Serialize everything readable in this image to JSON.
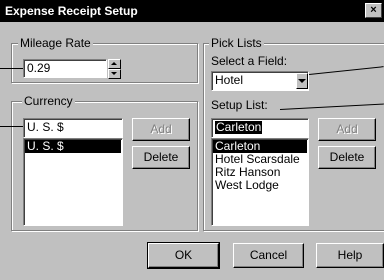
{
  "window": {
    "title": "Expense Receipt Setup",
    "close_label": "×"
  },
  "mileage": {
    "legend": "Mileage Rate",
    "value": "0.29"
  },
  "currency": {
    "legend": "Currency",
    "input_value": "U. S. $",
    "items": [
      "U. S. $"
    ],
    "add_label": "Add",
    "delete_label": "Delete"
  },
  "picklists": {
    "legend": "Pick Lists",
    "field_label": "Select a Field:",
    "field_value": "Hotel",
    "setup_label": "Setup List:",
    "setup_input": "Carleton",
    "items": [
      "Carleton",
      "Hotel Scarsdale",
      "Ritz Hanson",
      "West Lodge"
    ],
    "add_label": "Add",
    "delete_label": "Delete"
  },
  "buttons": {
    "ok": "OK",
    "cancel": "Cancel",
    "help": "Help"
  }
}
